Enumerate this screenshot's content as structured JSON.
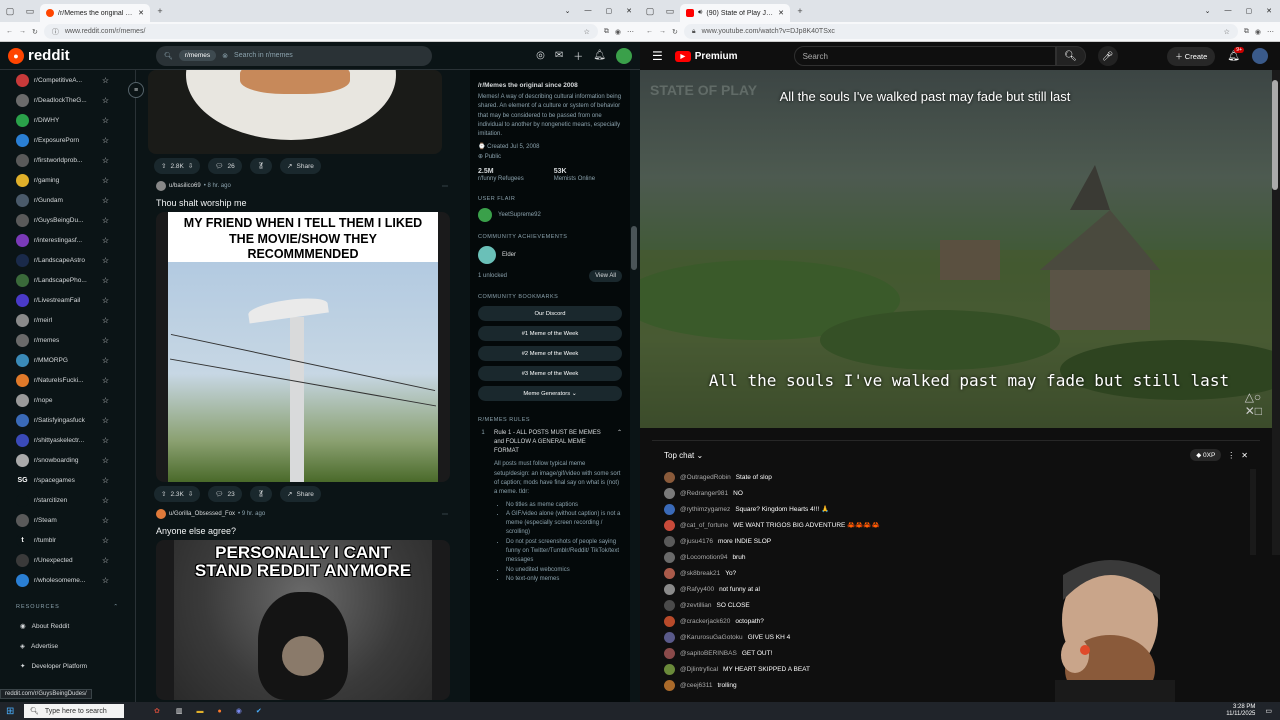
{
  "left_browser": {
    "tab_title": "/r/Memes the original since 20",
    "url": "www.reddit.com/r/memes/",
    "status_url": "reddit.com/r/GuysBeingDudes/"
  },
  "reddit": {
    "logo_text": "reddit",
    "search_chip": "r/memes",
    "search_placeholder": "Search in r/memes",
    "sidebar": [
      {
        "label": "r/CompetitiveA...",
        "color": "#c83a3a"
      },
      {
        "label": "r/DeadlockTheG...",
        "color": "#6b6b6b"
      },
      {
        "label": "r/DiWHY",
        "color": "#2aa24a"
      },
      {
        "label": "r/ExposurePorn",
        "color": "#2a7fd4"
      },
      {
        "label": "r/firstworldprob...",
        "color": "#5a5a5a"
      },
      {
        "label": "r/gaming",
        "color": "#e0b02a"
      },
      {
        "label": "r/Gundam",
        "color": "#4a5a6a"
      },
      {
        "label": "r/GuysBeingDu...",
        "color": "#5a5a5a"
      },
      {
        "label": "r/interestingasf...",
        "color": "#7a3ab8"
      },
      {
        "label": "r/LandscapeAstro",
        "color": "#1a2a4a"
      },
      {
        "label": "r/LandscapePho...",
        "color": "#3a6a3a"
      },
      {
        "label": "r/LivestreamFail",
        "color": "#4a3ac8"
      },
      {
        "label": "r/meirl",
        "color": "#8a8a8a"
      },
      {
        "label": "r/memes",
        "color": "#6a6a6a"
      },
      {
        "label": "r/MMORPG",
        "color": "#3a8ab8"
      },
      {
        "label": "r/NatureIsFucki...",
        "color": "#e07a2a"
      },
      {
        "label": "r/nope",
        "color": "#9a9a9a"
      },
      {
        "label": "r/Satisfyingasfuck",
        "color": "#3a6ab8"
      },
      {
        "label": "r/shittyaskelectr...",
        "color": "#3a4ab8"
      },
      {
        "label": "r/snowboarding",
        "color": "#aaaaaa"
      },
      {
        "label": "r/spacegames",
        "color": "#0b1416",
        "text": "SG"
      },
      {
        "label": "r/starcitizen",
        "color": "#0b1416"
      },
      {
        "label": "r/Steam",
        "color": "#5a5a5a"
      },
      {
        "label": "r/tumblr",
        "color": "#0b1416",
        "text": "t"
      },
      {
        "label": "r/Unexpected",
        "color": "#3a3a3a"
      },
      {
        "label": "r/wholesomeme...",
        "color": "#2a7fd4"
      }
    ],
    "resources_heading": "RESOURCES",
    "resources": [
      "About Reddit",
      "Advertise",
      "Developer Platform"
    ],
    "post0": {
      "upvotes": "2.8K",
      "comments": "26",
      "share": "Share"
    },
    "post1": {
      "author": "u/basilico69",
      "age": "• 8 hr. ago",
      "title": "Thou shalt worship me",
      "meme_text": "MY FRIEND WHEN I TELL THEM I LIKED THE MOVIE/SHOW THEY RECOMMMENDED",
      "upvotes": "2.3K",
      "comments": "23",
      "share": "Share"
    },
    "post2": {
      "author": "u/Gorilla_Obsessed_Fox",
      "age": "• 9 hr. ago",
      "title": "Anyone else agree?",
      "meme_line1": "PERSONALLY I CANT",
      "meme_line2": "STAND REDDIT ANYMORE"
    },
    "about": {
      "title": "/r/Memes the original since 2008",
      "desc": "Memes! A way of describing cultural information being shared. An element of a culture or system of behavior that may be considered to be passed from one individual to another by nongenetic means, especially imitation.",
      "created": "Created Jul 5, 2008",
      "visibility": "Public",
      "members": "2.5M",
      "members_label": "r/funny Refugees",
      "online": "53K",
      "online_label": "Memists Online"
    },
    "user_flair_label": "USER FLAIR",
    "user_flair_name": "YeetSupreme92",
    "achievements_label": "COMMUNITY ACHIEVEMENTS",
    "achievement_name": "Elder",
    "achievement_unlocked": "1 unlocked",
    "view_all": "View All",
    "bookmarks_label": "COMMUNITY BOOKMARKS",
    "bookmarks": [
      "Our Discord",
      "#1 Meme of the Week",
      "#2 Meme of the Week",
      "#3 Meme of the Week",
      "Meme Generators"
    ],
    "rules_label": "R/MEMES RULES",
    "rule1_num": "1",
    "rule1_title": "Rule 1 - ALL POSTS MUST BE MEMES and FOLLOW A GENERAL MEME FORMAT",
    "rule1_desc": "All posts must follow typical meme setup/design: an image/gif/video with some sort of caption; mods have final say on what is (not) a meme. tldr:",
    "rule1_bullets": [
      "No titles as meme captions",
      "A GIF/video alone (without caption) is not a meme (especially screen recording / scrolling)",
      "Do not post screenshots of people saying funny on Twitter/Tumblr/Reddit/ TikTok/text messages",
      "No unedited webcomics",
      "No text-only memes"
    ]
  },
  "right_browser": {
    "tab_title": "(90) State of Play Japan | N",
    "url": "www.youtube.com/watch?v=DJp8K40TSxc"
  },
  "youtube": {
    "logo": "Premium",
    "search_placeholder": "Search",
    "create": "Create",
    "notif_count": "9+",
    "watermark": "STATE OF PLAY",
    "subtitle_top": "All the souls I've walked past may fade but still last",
    "subtitle_bottom": "All the souls I've walked past may fade but still last",
    "chat_mode": "Top chat",
    "xp_label": "0XP",
    "chat": [
      {
        "author": "@OutragedRobin",
        "text": "State of slop",
        "color": "#8a5a3a"
      },
      {
        "author": "@Redranger981",
        "text": "NO",
        "color": "#7a7a7a"
      },
      {
        "author": "@rythimzygamez",
        "text": "Square? Kingdom Hearts 4!!! 🙏",
        "color": "#3a6ab8"
      },
      {
        "author": "@cat_of_fortune",
        "text": "WE WANT TRIGOS BIG ADVENTURE 🦀🦀🦀🦀",
        "color": "#c84a3a"
      },
      {
        "author": "@jusu4176",
        "text": "more INDIE SLOP",
        "color": "#5a5a5a"
      },
      {
        "author": "@Locomotion94",
        "text": "bruh",
        "color": "#6a6a6a"
      },
      {
        "author": "@sk8break21",
        "text": "Yo?",
        "color": "#aa5a4a"
      },
      {
        "author": "@Rafyy400",
        "text": "not funny at al",
        "color": "#8a8a8a"
      },
      {
        "author": "@zevtillian",
        "text": "SO CLOSE",
        "color": "#4a4a4a"
      },
      {
        "author": "@crackerjack620",
        "text": "octopath?",
        "color": "#b84a2a"
      },
      {
        "author": "@KarurosuGaGotoku",
        "text": "GIVE US KH 4",
        "color": "#5a5a8a"
      },
      {
        "author": "@sapitoBERINBAS",
        "text": "GET OUT!",
        "color": "#8a4a4a"
      },
      {
        "author": "@Djlintryfical",
        "text": "MY HEART SKIPPED A BEAT",
        "color": "#6a8a3a"
      },
      {
        "author": "@ceej6311",
        "text": "trolling",
        "color": "#aa6a2a"
      }
    ]
  },
  "taskbar": {
    "search_placeholder": "Type here to search",
    "time": "3:28 PM",
    "date": "11/11/2025"
  }
}
